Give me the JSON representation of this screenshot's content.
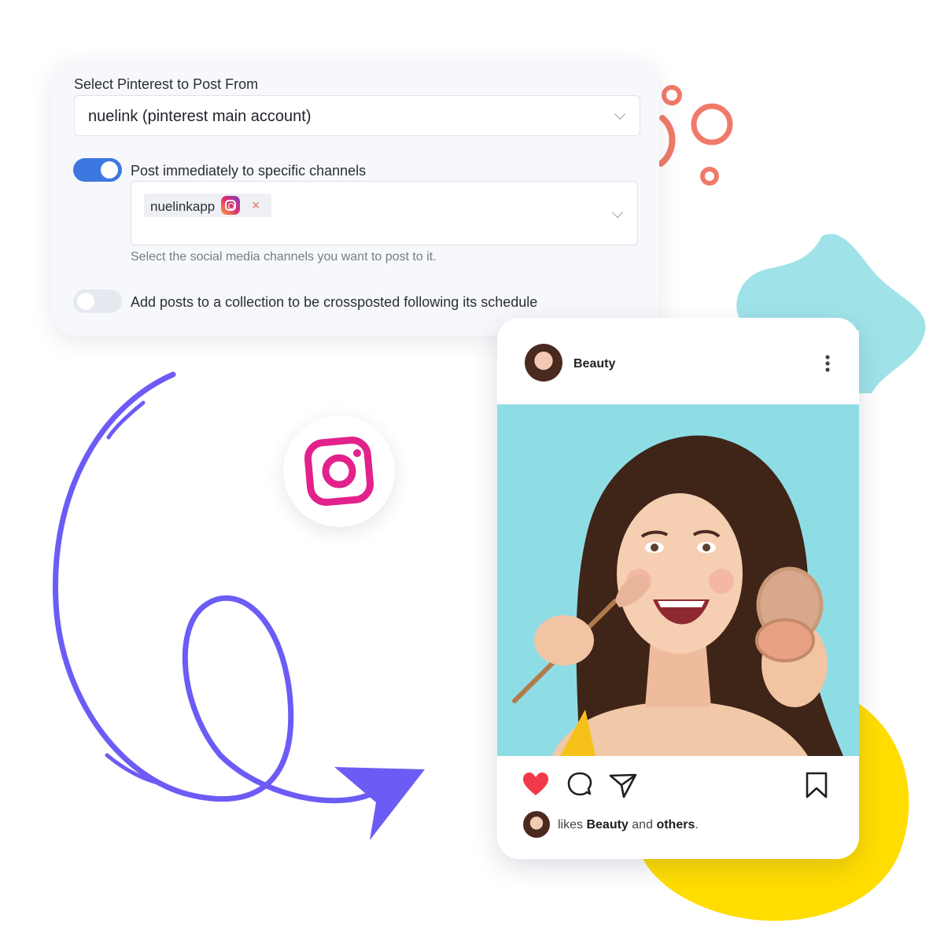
{
  "settings": {
    "account_select_label": "Select Pinterest to Post From",
    "account_select_value": "nuelink (pinterest main account)",
    "toggle_immediate": {
      "label": "Post immediately to specific channels",
      "on": true
    },
    "channels": {
      "chips": [
        {
          "label": "nuelinkapp",
          "network_icon": "instagram-icon",
          "remove": "×"
        }
      ],
      "help": "Select the social media channels you want to post to it."
    },
    "toggle_collection": {
      "label": "Add posts to a collection to be crossposted following its schedule",
      "on": false
    }
  },
  "post": {
    "account_name": "Beauty",
    "likes_prefix": "likes",
    "likes_user": "Beauty",
    "likes_and": "and",
    "likes_others": "others",
    "likes_suffix": "."
  },
  "icons": {
    "bubble": "instagram-icon",
    "header_menu": "more-vertical-icon",
    "actions": [
      "heart-icon",
      "comment-icon",
      "send-icon",
      "bookmark-icon"
    ]
  },
  "colors": {
    "toggle_on": "#3d78e0",
    "instagram_pink": "#e3218c",
    "heart": "#f2394b",
    "arrow": "#6c5cf5",
    "blob_teal": "#9fe3e8",
    "blob_yellow": "#ffdd00",
    "rings": "#f07a6a"
  }
}
